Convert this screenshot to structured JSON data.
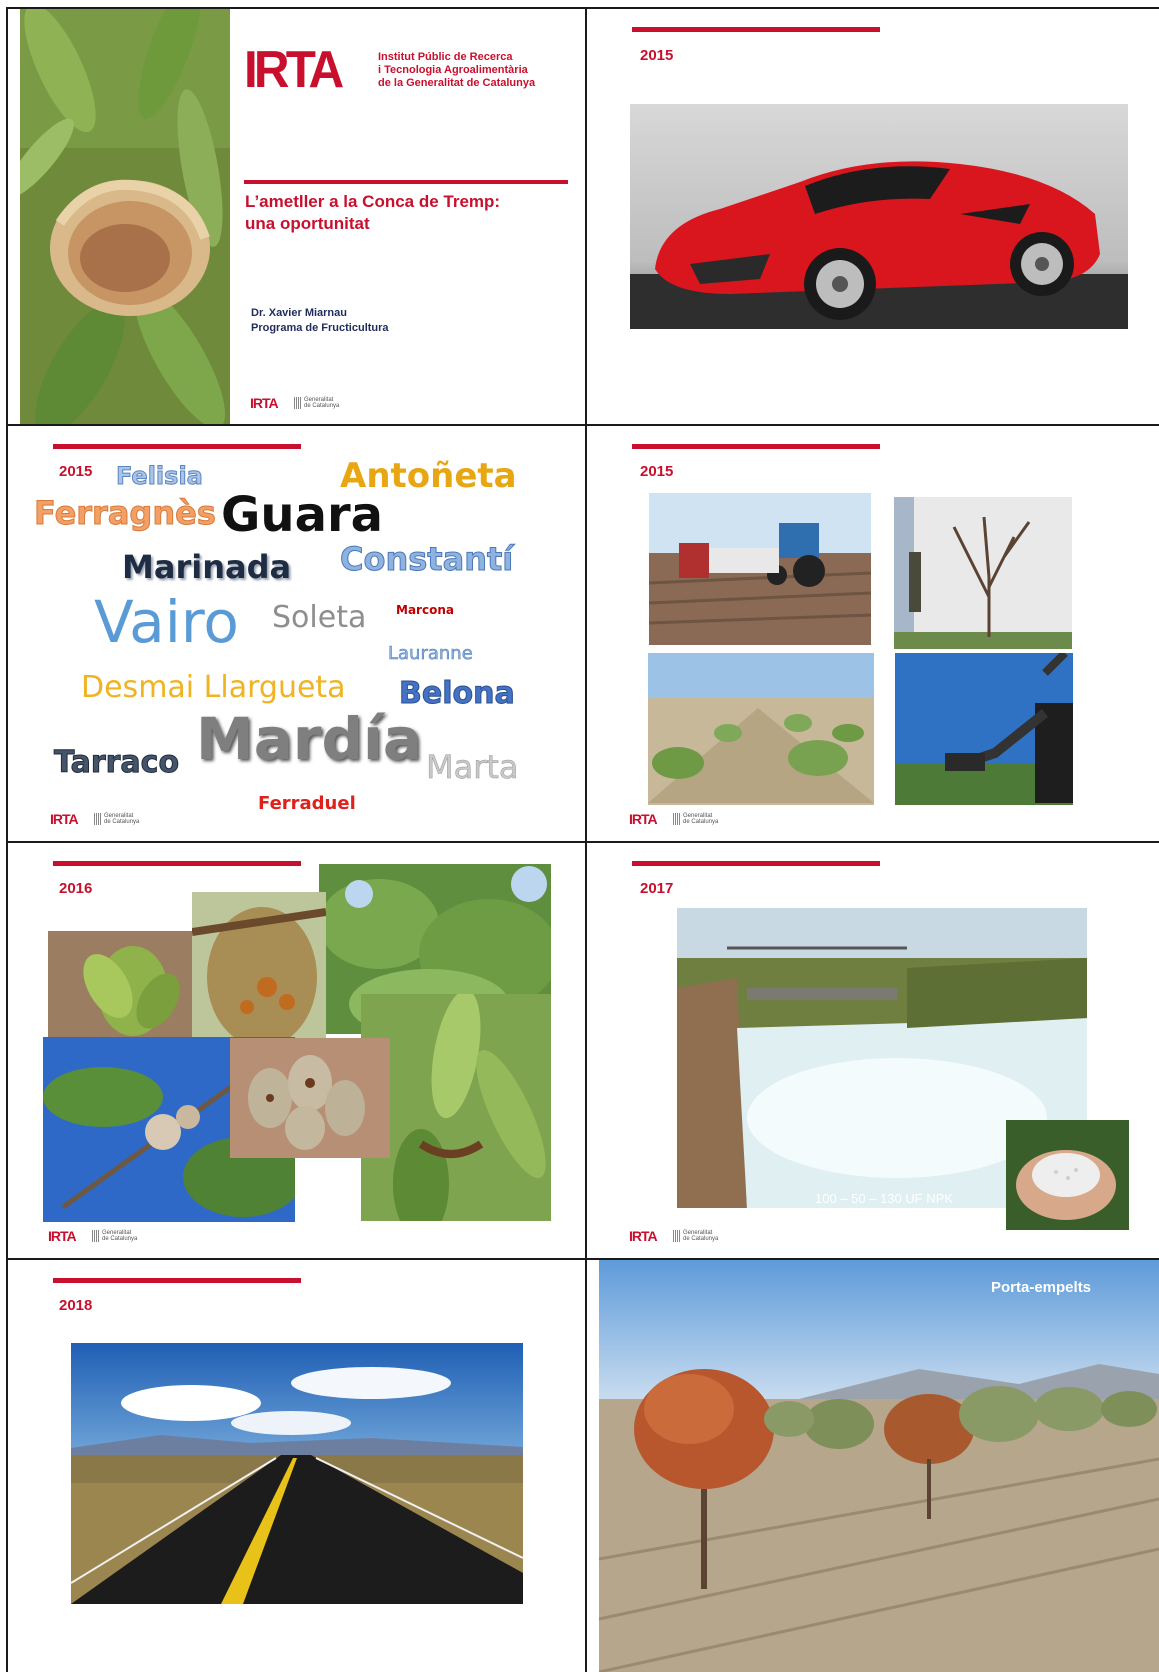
{
  "title_slide": {
    "logo": "IRTA",
    "institute": [
      "Institut Públic de Recerca",
      "i Tecnologia Agroalimentària",
      "de la Generalitat de Catalunya"
    ],
    "title_line1": "L’ametller a la Conca de Tremp:",
    "title_line2": "una oportunitat",
    "author": "Dr. Xavier Miarnau",
    "program": "Programa de Fructicultura"
  },
  "footer": {
    "irta": "IRTA",
    "gen_line1": "Generalitat",
    "gen_line2": "de Catalunya"
  },
  "slide2": {
    "year": "2015"
  },
  "slide3": {
    "year": "2015",
    "varieties": [
      {
        "text": "Felisia",
        "color": "#a9c4e8"
      },
      {
        "text": "Antoñeta",
        "color": "#e8a712"
      },
      {
        "text": "Ferragnès",
        "color": "#f2a065"
      },
      {
        "text": "Guara",
        "color": "#111111"
      },
      {
        "text": "Marinada",
        "color": "#1f2d44"
      },
      {
        "text": "Constantí",
        "color": "#8fb3e0"
      },
      {
        "text": "Vairo",
        "color": "#5b9bd5"
      },
      {
        "text": "Soleta",
        "color": "#8e8e8e"
      },
      {
        "text": "Marcona",
        "color": "#c00000"
      },
      {
        "text": "Lauranne",
        "color": "#8fb3e0"
      },
      {
        "text": "Desmai Llargueta",
        "color": "#f0b323"
      },
      {
        "text": "Belona",
        "color": "#4472c4"
      },
      {
        "text": "Tarraco",
        "color": "#44546a"
      },
      {
        "text": "Mardía",
        "color": "#7f7f7f"
      },
      {
        "text": "Marta",
        "color": "#c9c9c9"
      },
      {
        "text": "Ferraduel",
        "color": "#e0201a"
      }
    ]
  },
  "slide4": {
    "year": "2015"
  },
  "slide5": {
    "year": "2016"
  },
  "slide6": {
    "year": "2017",
    "npk_label": "100 – 50 – 130 UF NPK"
  },
  "slide7": {
    "year": "2018"
  },
  "slide8": {
    "caption": "Porta-empelts"
  },
  "colors": {
    "accent": "#c8102e",
    "navy": "#1f2d5c"
  }
}
